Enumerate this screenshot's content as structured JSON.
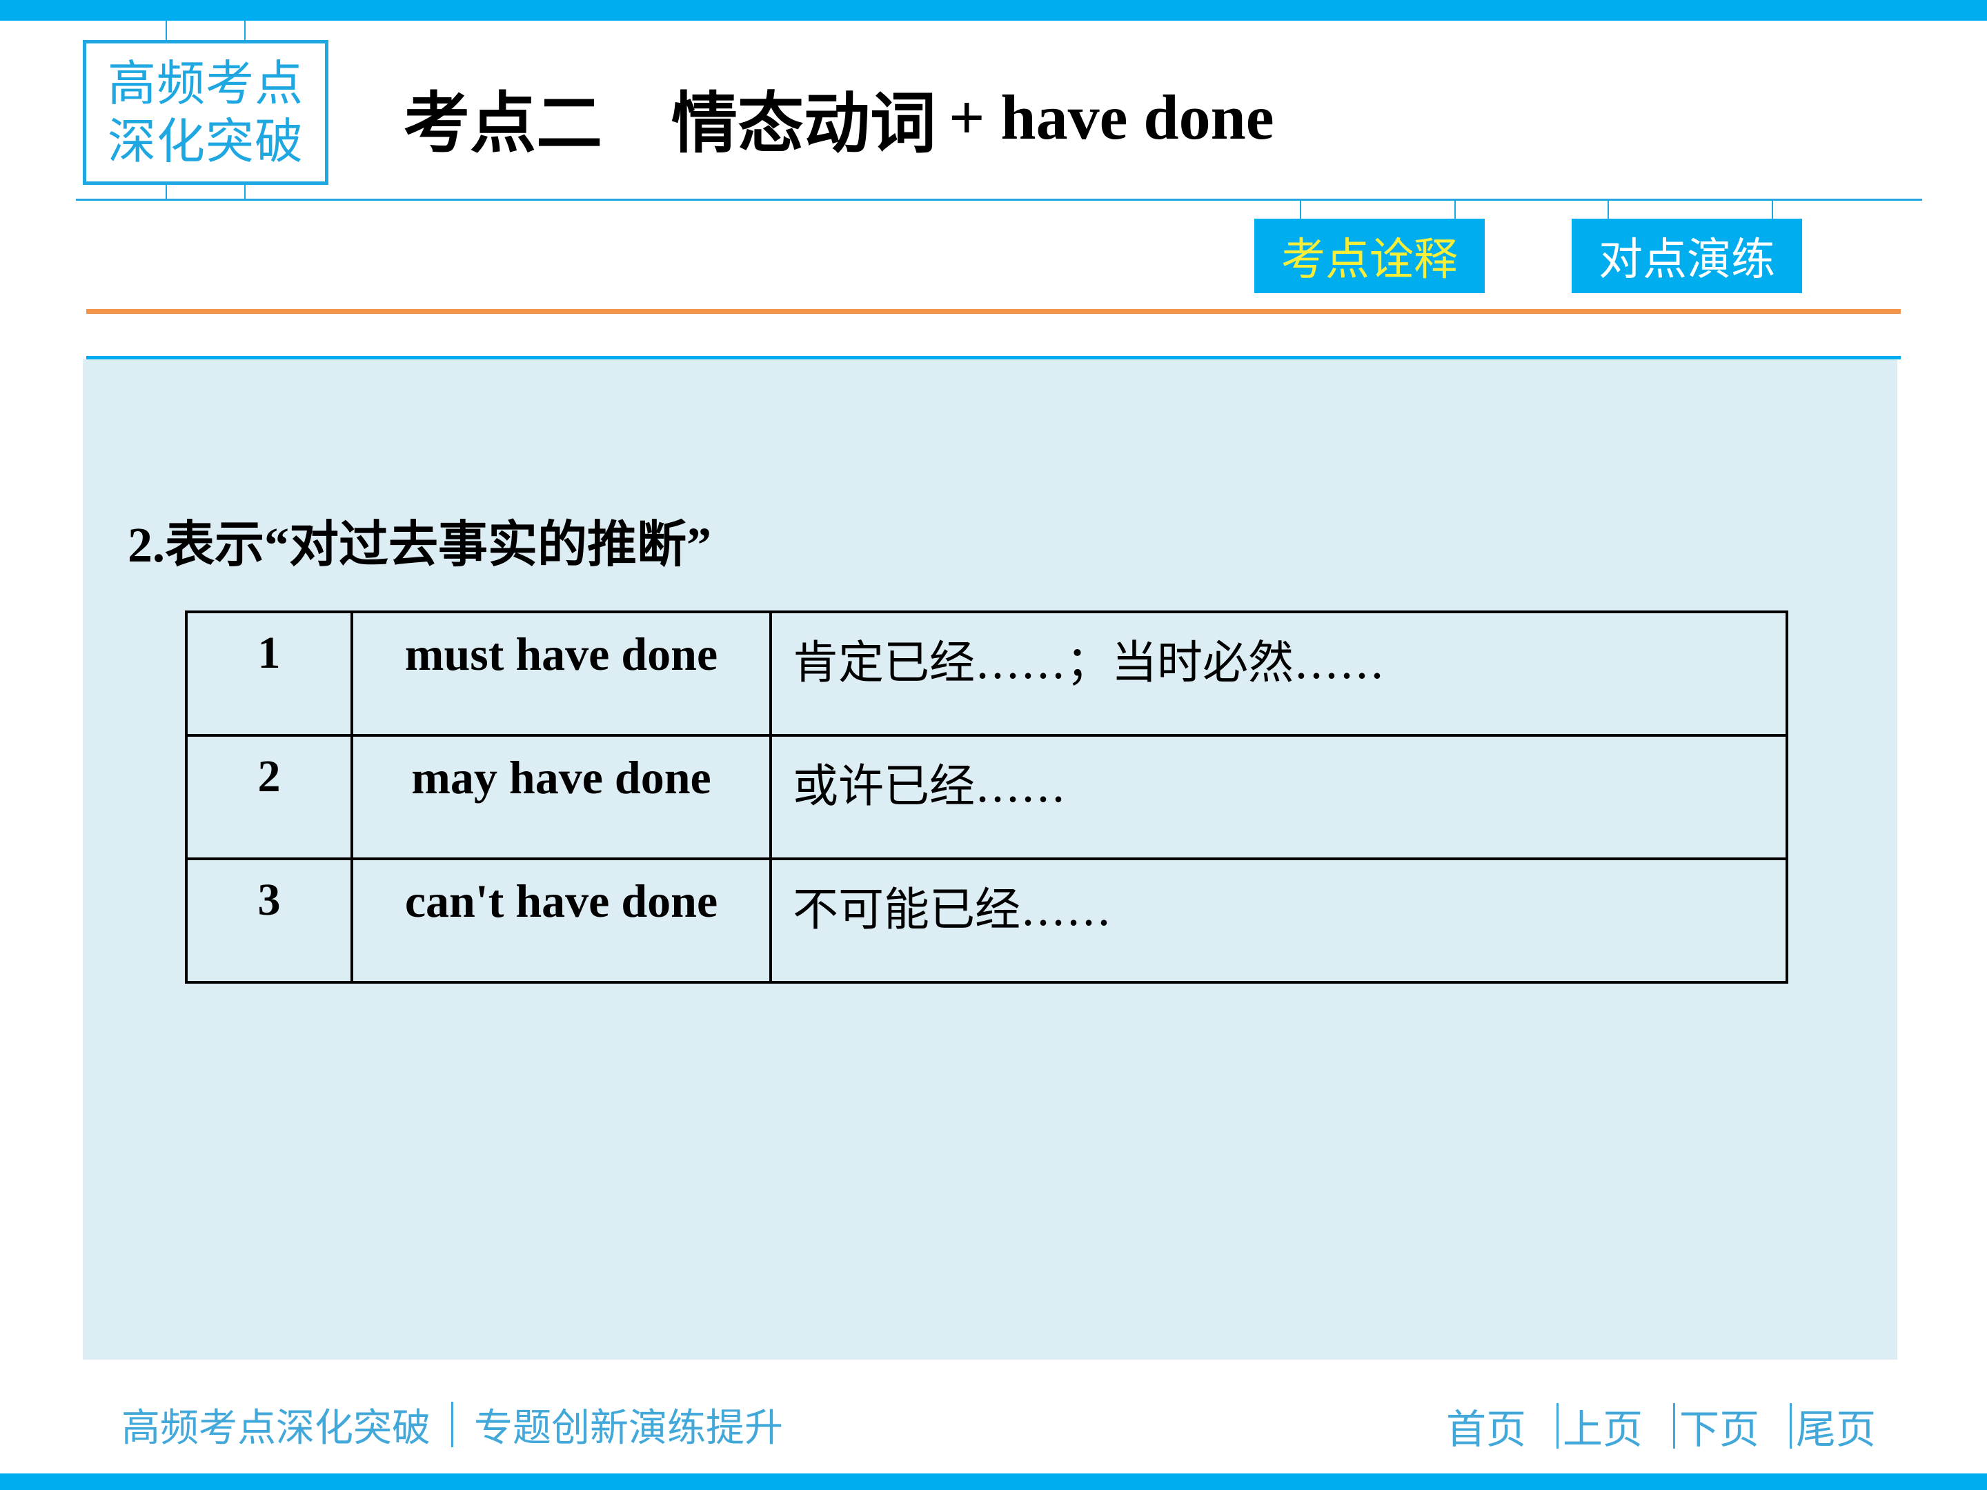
{
  "header": {
    "logo_line1": "高频考点",
    "logo_line2": "深化突破",
    "title_cn_part1": "考点二",
    "title_cn_part2": "情态动词",
    "title_en": "+ have done"
  },
  "tabs": [
    {
      "label": "考点诠释",
      "active": true
    },
    {
      "label": "对点演练",
      "active": false
    }
  ],
  "content": {
    "heading": "2.表示“对过去事实的推断”",
    "rows": [
      {
        "num": "1",
        "phrase": "must have done",
        "meaning": "肯定已经……；当时必然……"
      },
      {
        "num": "2",
        "phrase": "may have done",
        "meaning": "或许已经……"
      },
      {
        "num": "3",
        "phrase": "can't have done",
        "meaning": "不可能已经……"
      }
    ]
  },
  "footer": {
    "left_part1": "高频考点深化突破",
    "left_part2": "专题创新演练提升",
    "nav": [
      "首页",
      "上页",
      "下页",
      "尾页"
    ]
  },
  "colors": {
    "brand_blue": "#00adef",
    "accent_orange": "#f0954b",
    "active_tab_text": "#f7ee39",
    "panel_bg": "#dcedf3",
    "footer_text": "#42a8d9"
  }
}
